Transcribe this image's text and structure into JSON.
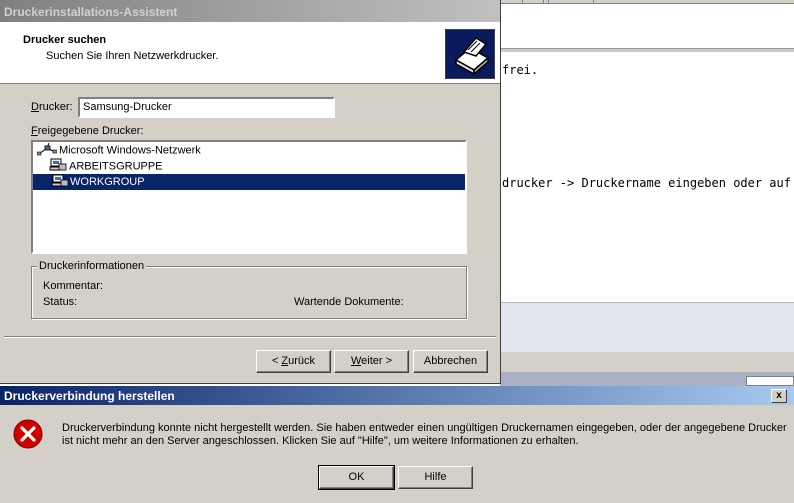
{
  "background": {
    "line1": "frei.",
    "line2": "drucker -> Druckername eingeben oder auf W"
  },
  "wizard": {
    "title": "Druckerinstallations-Assistent",
    "header_title": "Drucker suchen",
    "header_subtitle": "Suchen Sie Ihren Netzwerkdrucker.",
    "printer_label_accel": "D",
    "printer_label_rest": "rucker:",
    "printer_value": "Samsung-Drucker",
    "shared_label_accel": "F",
    "shared_label_rest": "reigegebene Drucker:",
    "tree": [
      {
        "label": "Microsoft Windows-Netzwerk"
      },
      {
        "label": "ARBEITSGRUPPE"
      },
      {
        "label": "WORKGROUP"
      }
    ],
    "info_group_title": "Druckerinformationen",
    "comment_label": "Kommentar:",
    "status_label": "Status:",
    "waiting_label": "Wartende Dokumente:",
    "back_prefix": "< ",
    "back_accel": "Z",
    "back_rest": "urück",
    "next_accel": "W",
    "next_rest": "eiter >",
    "cancel_label": "Abbrechen"
  },
  "error_dialog": {
    "title": "Druckerverbindung herstellen",
    "close_glyph": "x",
    "message": "Druckerverbindung konnte nicht hergestellt werden.  Sie haben entweder einen ungültigen Druckernamen eingegeben, oder der angegebene Drucker ist nicht mehr an den Server angeschlossen. Klicken Sie auf \"Hilfe\", um weitere Informationen zu erhalten.",
    "ok_label": "OK",
    "help_label": "Hilfe"
  },
  "colors": {
    "selection": "#0a246a",
    "error_red": "#d40000",
    "dialog_face": "#d4d0c8"
  }
}
